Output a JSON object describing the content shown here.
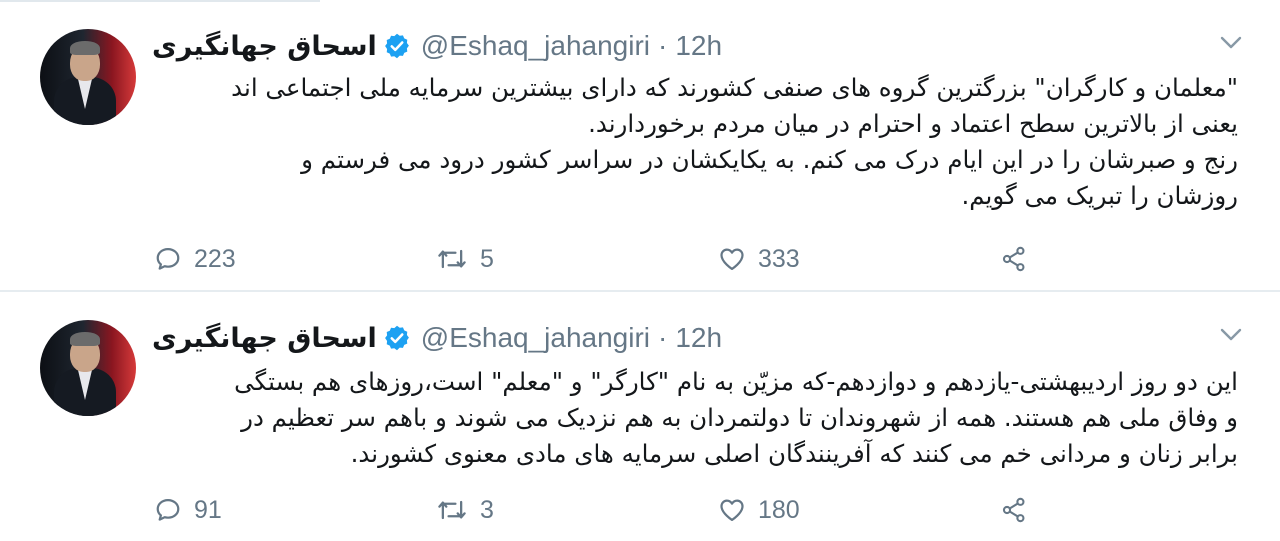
{
  "tweets": [
    {
      "author": {
        "name": "اسحاق جهانگیری",
        "handle": "@Eshaq_jahangiri",
        "verified": true
      },
      "time": "12h",
      "separator": "·",
      "lines": [
        "\"معلمان و کارگران\" بزرگترین گروه های صنفی کشورند که دارای بیشترین سرمایه ملی اجتماعی اند",
        "یعنی از بالاترین سطح اعتماد و احترام در میان مردم برخوردارند.",
        "رنج و صبرشان را در این ایام درک می کنم. به یکایکشان در سراسر کشور درود می فرستم و",
        "روزشان را تبریک می گویم."
      ],
      "replies": "223",
      "retweets": "5",
      "likes": "333"
    },
    {
      "author": {
        "name": "اسحاق جهانگیری",
        "handle": "@Eshaq_jahangiri",
        "verified": true
      },
      "time": "12h",
      "separator": "·",
      "lines": [
        "این دو روز اردیبهشتی-یازدهم و دوازدهم-که مزیّن به نام \"کارگر\" و \"معلم\" است،روزهای هم بستگی",
        "و وفاق ملی هم هستند. همه از شهروندان تا دولتمردان به هم نزدیک می شوند و باهم سر تعظیم در",
        "برابر زنان و مردانی خم می کنند که آفرینندگان اصلی سرمایه های مادی معنوی کشورند."
      ],
      "replies": "91",
      "retweets": "3",
      "likes": "180"
    }
  ],
  "colors": {
    "verified": "#1da1f2",
    "muted": "#657786",
    "divider": "#e6ecf0",
    "text": "#14171a"
  },
  "icons": [
    "verified-badge-icon",
    "chevron-down-icon",
    "reply-icon",
    "retweet-icon",
    "like-icon",
    "share-icon"
  ]
}
